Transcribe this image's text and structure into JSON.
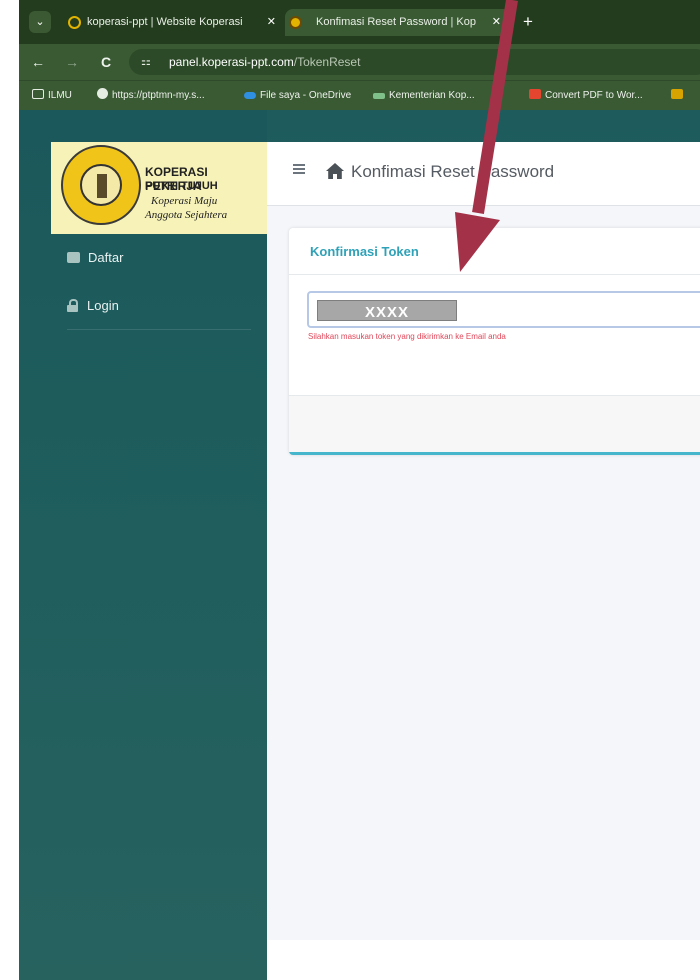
{
  "browser": {
    "tabs": [
      {
        "title": "koperasi-ppt | Website Koperasi",
        "active": false
      },
      {
        "title": "Konfimasi Reset Password | Kop",
        "active": true
      }
    ],
    "close_glyph": "✕",
    "new_tab_glyph": "+",
    "menu_glyph": "⌄",
    "back_glyph": "←",
    "forward_glyph": "→",
    "reload_glyph": "C",
    "site_info_glyph": "⚏",
    "url_domain": "panel.koperasi-ppt.com",
    "url_path": "/TokenReset",
    "bookmarks": [
      {
        "label": "ILMU",
        "icon": "folder-icon"
      },
      {
        "label": "https://ptptmn-my.s...",
        "icon": "globe-icon"
      },
      {
        "label": "File saya - OneDrive",
        "icon": "onedrive-icon"
      },
      {
        "label": "Kementerian Kop...",
        "icon": "ministry-icon"
      },
      {
        "label": "Convert PDF to Wor...",
        "icon": "pdf-icon"
      }
    ]
  },
  "sidebar": {
    "logo": {
      "seal_top": "KOPERASI PEKERJA",
      "seal_bottom": "PUTRI TUJUH",
      "line1": "KOPERASI PEKERJA",
      "line2": "PUTRI TUJUH",
      "line3": "Koperasi Maju",
      "line4": "Anggota Sejahtera"
    },
    "items": [
      {
        "label": "Daftar",
        "icon": "id-card-icon"
      },
      {
        "label": "Login",
        "icon": "lock-icon"
      }
    ]
  },
  "header": {
    "hamburger_icon": "menu-icon",
    "home_icon": "home-icon",
    "title": "Konfimasi Reset Password"
  },
  "card": {
    "title": "Konfirmasi Token",
    "token_value": "XXXX",
    "help_text": "Silahkan masukan token yang dikirimkan ke Email anda"
  },
  "colors": {
    "sidebar_bg": "#1d5b5d",
    "accent": "#45b6cc",
    "title_accent": "#2fa2b8",
    "error_text": "#e0485a",
    "logo_bg": "#f7f3b8",
    "annotation_arrow": "#a33148"
  }
}
